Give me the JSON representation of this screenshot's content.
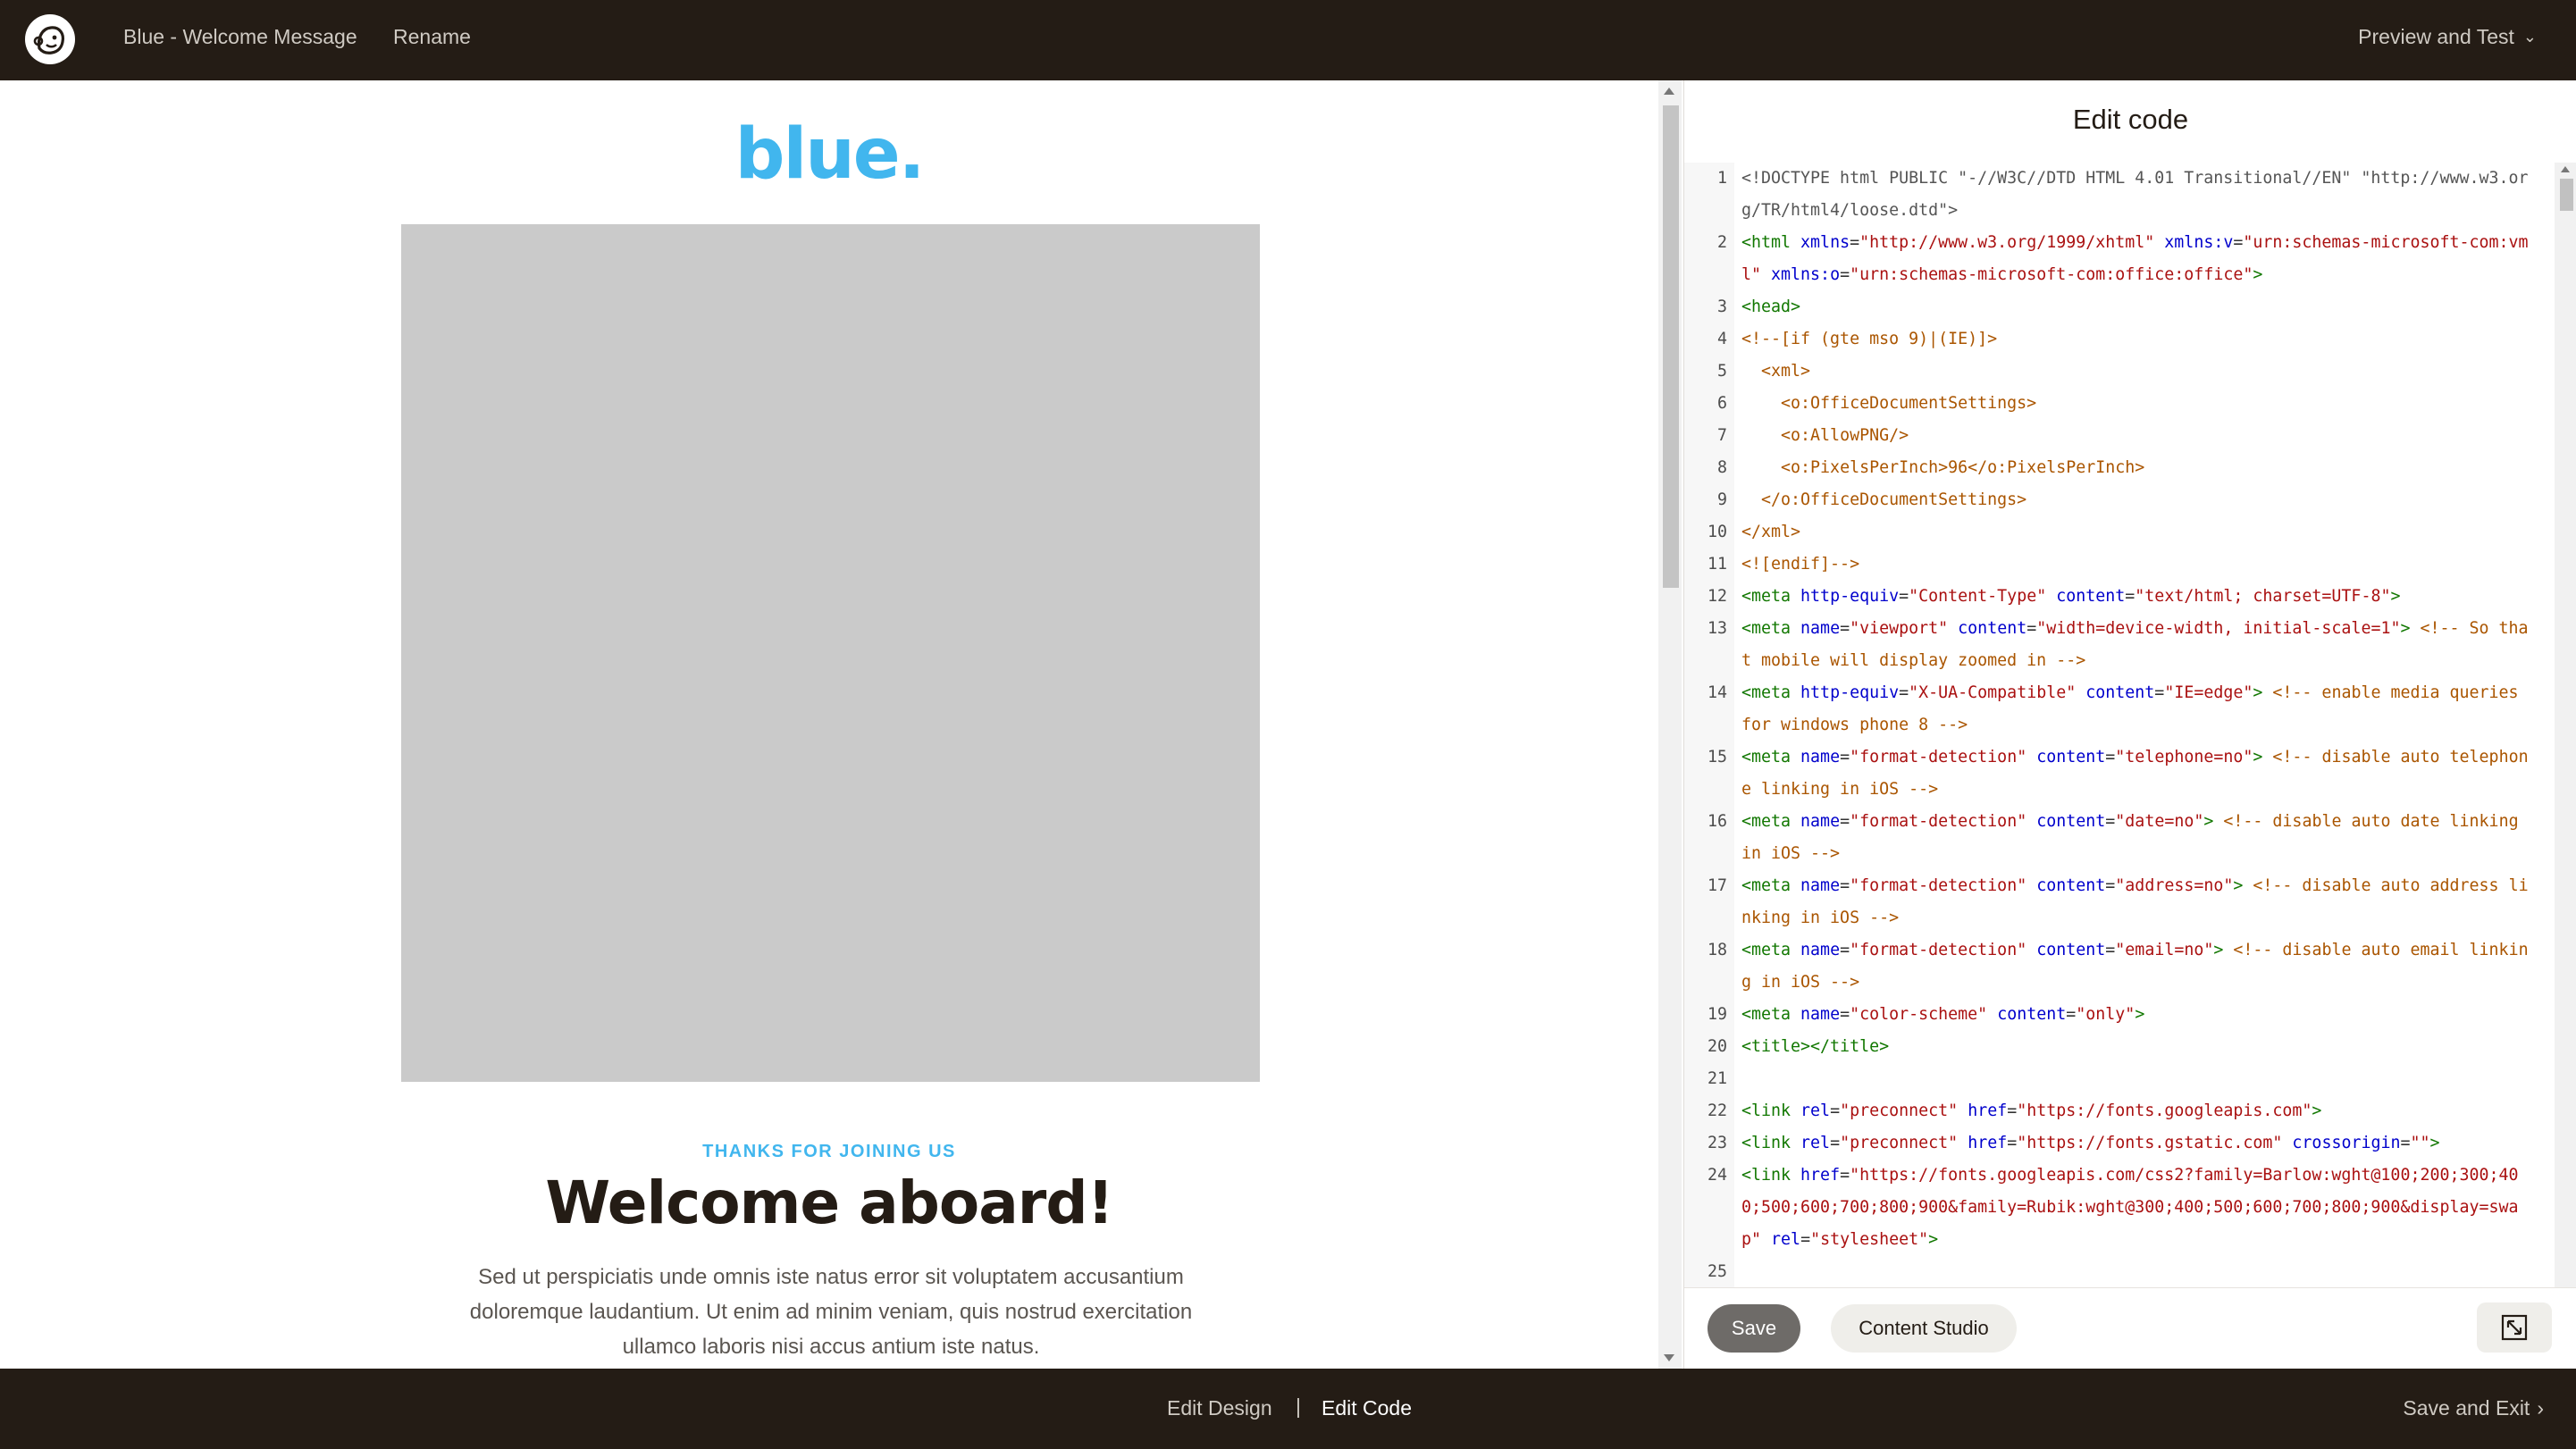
{
  "topbar": {
    "campaign_title": "Blue - Welcome Message",
    "rename": "Rename",
    "preview_test": "Preview and Test",
    "chevron": "⌄"
  },
  "preview": {
    "brand_text": "blue",
    "brand_dot": ".",
    "brand_color": "#41b6ee",
    "kicker": "THANKS FOR JOINING US",
    "headline": "Welcome aboard!",
    "body": "Sed ut perspiciatis unde omnis iste natus error sit voluptatem accusantium doloremque laudantium. Ut enim ad minim veniam, quis nostrud exercitation ullamco laboris nisi accus antium iste natus."
  },
  "editor": {
    "title": "Edit code",
    "save_label": "Save",
    "content_studio_label": "Content Studio",
    "lines": [
      {
        "n": "1",
        "html": "<span class=\"tok-meta\">&lt;!DOCTYPE html PUBLIC \"-//W3C//DTD HTML 4.01 Transitional//EN\" \"http://www.w3.org/TR/html4/loose.dtd\"&gt;</span>"
      },
      {
        "n": "2",
        "html": "<span class=\"tok-tag\">&lt;html</span> <span class=\"tok-attr\">xmlns</span>=<span class=\"tok-str\">\"http://www.w3.org/1999/xhtml\"</span> <span class=\"tok-attr\">xmlns:v</span>=<span class=\"tok-str\">\"urn:schemas-microsoft-com:vml\"</span> <span class=\"tok-attr\">xmlns:o</span>=<span class=\"tok-str\">\"urn:schemas-microsoft-com:office:office\"</span><span class=\"tok-tag\">&gt;</span>"
      },
      {
        "n": "3",
        "html": "<span class=\"tok-tag\">&lt;head&gt;</span>"
      },
      {
        "n": "4",
        "html": "<span class=\"tok-cmt\">&lt;!--[if (gte mso 9)|(IE)]&gt;</span>"
      },
      {
        "n": "5",
        "html": "<span class=\"tok-cmt\">  &lt;xml&gt;</span>"
      },
      {
        "n": "6",
        "html": "<span class=\"tok-cmt\">    &lt;o:OfficeDocumentSettings&gt;</span>"
      },
      {
        "n": "7",
        "html": "<span class=\"tok-cmt\">    &lt;o:AllowPNG/&gt;</span>"
      },
      {
        "n": "8",
        "html": "<span class=\"tok-cmt\">    &lt;o:PixelsPerInch&gt;96&lt;/o:PixelsPerInch&gt;</span>"
      },
      {
        "n": "9",
        "html": "<span class=\"tok-cmt\">  &lt;/o:OfficeDocumentSettings&gt;</span>"
      },
      {
        "n": "10",
        "html": "<span class=\"tok-cmt\">&lt;/xml&gt;</span>"
      },
      {
        "n": "11",
        "html": "<span class=\"tok-cmt\">&lt;![endif]--&gt;</span>"
      },
      {
        "n": "12",
        "html": "<span class=\"tok-tag\">&lt;meta</span> <span class=\"tok-attr\">http-equiv</span>=<span class=\"tok-str\">\"Content-Type\"</span> <span class=\"tok-attr\">content</span>=<span class=\"tok-str\">\"text/html; charset=UTF-8\"</span><span class=\"tok-tag\">&gt;</span>"
      },
      {
        "n": "13",
        "html": "<span class=\"tok-tag\">&lt;meta</span> <span class=\"tok-attr\">name</span>=<span class=\"tok-str\">\"viewport\"</span> <span class=\"tok-attr\">content</span>=<span class=\"tok-str\">\"width=device-width, initial-scale=1\"</span><span class=\"tok-tag\">&gt;</span> <span class=\"tok-cmt\">&lt;!-- So that mobile will display zoomed in --&gt;</span>"
      },
      {
        "n": "14",
        "html": "<span class=\"tok-tag\">&lt;meta</span> <span class=\"tok-attr\">http-equiv</span>=<span class=\"tok-str\">\"X-UA-Compatible\"</span> <span class=\"tok-attr\">content</span>=<span class=\"tok-str\">\"IE=edge\"</span><span class=\"tok-tag\">&gt;</span> <span class=\"tok-cmt\">&lt;!-- enable media queries for windows phone 8 --&gt;</span>"
      },
      {
        "n": "15",
        "html": "<span class=\"tok-tag\">&lt;meta</span> <span class=\"tok-attr\">name</span>=<span class=\"tok-str\">\"format-detection\"</span> <span class=\"tok-attr\">content</span>=<span class=\"tok-str\">\"telephone=no\"</span><span class=\"tok-tag\">&gt;</span> <span class=\"tok-cmt\">&lt;!-- disable auto telephone linking in iOS --&gt;</span>"
      },
      {
        "n": "16",
        "html": "<span class=\"tok-tag\">&lt;meta</span> <span class=\"tok-attr\">name</span>=<span class=\"tok-str\">\"format-detection\"</span> <span class=\"tok-attr\">content</span>=<span class=\"tok-str\">\"date=no\"</span><span class=\"tok-tag\">&gt;</span> <span class=\"tok-cmt\">&lt;!-- disable auto date linking in iOS --&gt;</span>"
      },
      {
        "n": "17",
        "html": "<span class=\"tok-tag\">&lt;meta</span> <span class=\"tok-attr\">name</span>=<span class=\"tok-str\">\"format-detection\"</span> <span class=\"tok-attr\">content</span>=<span class=\"tok-str\">\"address=no\"</span><span class=\"tok-tag\">&gt;</span> <span class=\"tok-cmt\">&lt;!-- disable auto address linking in iOS --&gt;</span>"
      },
      {
        "n": "18",
        "html": "<span class=\"tok-tag\">&lt;meta</span> <span class=\"tok-attr\">name</span>=<span class=\"tok-str\">\"format-detection\"</span> <span class=\"tok-attr\">content</span>=<span class=\"tok-str\">\"email=no\"</span><span class=\"tok-tag\">&gt;</span> <span class=\"tok-cmt\">&lt;!-- disable auto email linking in iOS --&gt;</span>"
      },
      {
        "n": "19",
        "html": "<span class=\"tok-tag\">&lt;meta</span> <span class=\"tok-attr\">name</span>=<span class=\"tok-str\">\"color-scheme\"</span> <span class=\"tok-attr\">content</span>=<span class=\"tok-str\">\"only\"</span><span class=\"tok-tag\">&gt;</span>"
      },
      {
        "n": "20",
        "html": "<span class=\"tok-tag\">&lt;title&gt;&lt;/title&gt;</span>"
      },
      {
        "n": "21",
        "html": ""
      },
      {
        "n": "22",
        "html": "<span class=\"tok-tag\">&lt;link</span> <span class=\"tok-attr\">rel</span>=<span class=\"tok-str\">\"preconnect\"</span> <span class=\"tok-attr\">href</span>=<span class=\"tok-str\">\"https://fonts.googleapis.com\"</span><span class=\"tok-tag\">&gt;</span>"
      },
      {
        "n": "23",
        "html": "<span class=\"tok-tag\">&lt;link</span> <span class=\"tok-attr\">rel</span>=<span class=\"tok-str\">\"preconnect\"</span> <span class=\"tok-attr\">href</span>=<span class=\"tok-str\">\"https://fonts.gstatic.com\"</span> <span class=\"tok-attr\">crossorigin</span>=<span class=\"tok-str\">\"\"</span><span class=\"tok-tag\">&gt;</span>"
      },
      {
        "n": "24",
        "html": "<span class=\"tok-tag\">&lt;link</span> <span class=\"tok-attr\">href</span>=<span class=\"tok-str\">\"https://fonts.googleapis.com/css2?family=Barlow:wght@100;200;300;400;500;600;700;800;900&amp;family=Rubik:wght@300;400;500;600;700;800;900&amp;display=swap\"</span> <span class=\"tok-attr\">rel</span>=<span class=\"tok-str\">\"stylesheet\"</span><span class=\"tok-tag\">&gt;</span>"
      },
      {
        "n": "25",
        "html": ""
      }
    ]
  },
  "bottombar": {
    "edit_design": "Edit Design",
    "divider": "|",
    "edit_code": "Edit Code",
    "save_exit": "Save and Exit",
    "chevron": "›"
  },
  "icons": {
    "app_logo": "mailchimp-freddie-icon",
    "expand": "expand-icon"
  }
}
